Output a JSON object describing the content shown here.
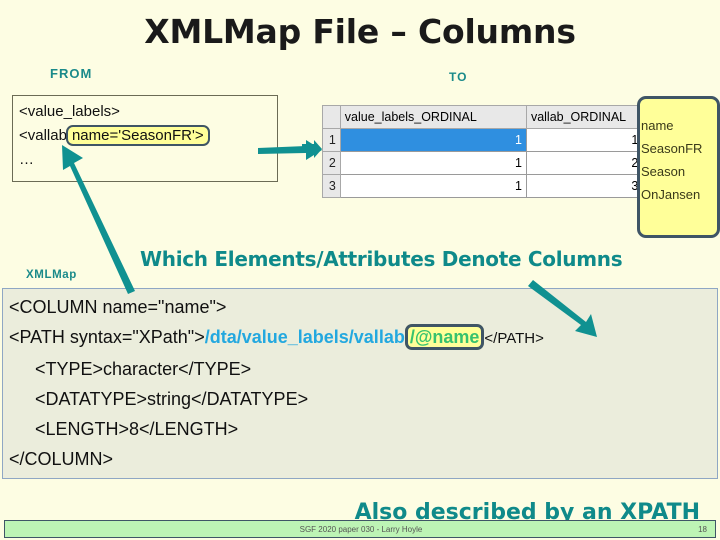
{
  "slide": {
    "title": "XMLMap File – Columns",
    "background_color": "#fdfde3",
    "accent_color": "#0f8a8a"
  },
  "labels": {
    "from": "FROM",
    "to": "TO",
    "xmlmap": "XMLMap"
  },
  "from_box": {
    "line1": "<value_labels>",
    "line2_prefix": "<vallab",
    "line2_highlight": "name='SeasonFR'>",
    "line3": "…"
  },
  "to_table": {
    "headers": [
      "",
      "value_labels_ORDINAL",
      "vallab_ORDINAL",
      "name"
    ],
    "rows": [
      {
        "num": "1",
        "value_labels_ORDINAL": "1",
        "vallab_ORDINAL": "1",
        "name": "SeasonFR",
        "selected": true
      },
      {
        "num": "2",
        "value_labels_ORDINAL": "1",
        "vallab_ORDINAL": "2",
        "name": "Season",
        "selected": false
      },
      {
        "num": "3",
        "value_labels_ORDINAL": "1",
        "vallab_ORDINAL": "3",
        "name": "OnJansen",
        "selected": false
      }
    ],
    "selection_color": "#2f8fe0",
    "highlight_color": "#ffff99"
  },
  "section_heading": "Which Elements/Attributes Denote Columns",
  "code_block": {
    "line1": "<COLUMN name=\"name\">",
    "line2_prefix": "<PATH syntax=\"XPath\">",
    "line2_xpath": "/dta/value_labels/vallab",
    "line2_highlight": "/@name",
    "line2_suffix": "</PATH>",
    "line3": "<TYPE>character</TYPE>",
    "line4": "<DATATYPE>string</DATATYPE>",
    "line5": "<LENGTH>8</LENGTH>",
    "line6": "</COLUMN>",
    "xpath_color": "#23a8df",
    "highlight_text_color": "#36c26e"
  },
  "bottom_heading": "Also described by an XPATH",
  "footer": {
    "text": "SGF 2020 paper 030 - Larry Hoyle",
    "page": "18",
    "background_color": "#bdf4b5"
  },
  "icons": {
    "arrow_right": "arrow-right-icon",
    "arrow_up_left": "arrow-up-left-icon",
    "arrow_down_right": "arrow-down-right-icon",
    "pointer_right": "pointer-right-icon"
  }
}
